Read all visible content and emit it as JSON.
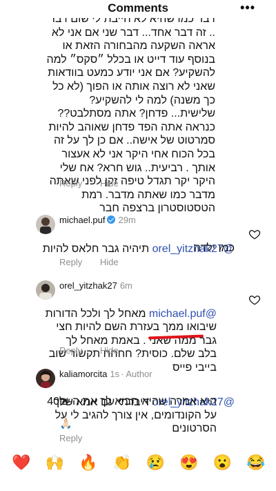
{
  "header": {
    "title": "Comments",
    "more_icon": "more-horizontal-icon"
  },
  "comments": [
    {
      "text": "דבר כמו שהיא לא חייבת לי שום דבר .. זה דבר אחד... דבר שני אם אני לא אראה השקעה מהבחורה הזאת או בנוסף עוד דייט או בכלל ״סקס״ למה להשקיע? אם אני יודע כמעט בוודאות שאני לא רוצה אותה או הפוך (לא כל כך משנה) למה לי להשקיע? שלישית... פדחן? אתה מסתלבט?? כנראה אתה הפד פדחן שאוהב להיות סמרטוט של אישה.. אם כן לך על זה בכל הכוח אחי היקר אני לא אעצור אותך . רביעית.. גוש חרא? אח שלי היקר יקר תגדל טיפה זקן לפני שאתה מדבר כמו שאתה מדבר. רמת הטסטוסטרון ברצפה חבר",
      "reply_label": "Reply",
      "hide_label": "Hide"
    },
    {
      "username": "michael.puf",
      "time": "29m",
      "mention": "@orel_yitzhak27",
      "text_line1": "תיהיה גבר חלאס להיות",
      "text_line2": "כמו ילדה",
      "reply_label": "Reply",
      "hide_label": "Hide"
    },
    {
      "username": "orel_yitzhak27",
      "time": "6m",
      "mention": "@michael.puf",
      "text": "מאחל לך ולכל הדורות שיבואו ממך בעזרת השם להיות חצי גבר ממה שאני . באמת מאחל לך בלב שלם. כוסית? חחחח תקשור שוב בייבי פייס",
      "reply_label": "Reply",
      "hide_label": "Hide"
    },
    {
      "username": "kaliamorcita",
      "time": "1s",
      "author_tag": "· Author",
      "mention": "@orel_yitzhak27",
      "text_line1": "דיברתי עם אמא שלך",
      "text_rest": "היא אמרה שהיא תביא לך את ה-40₪ על הקונדומים, אין צורך להגיב לי על הסרטונים",
      "emoji": "🙏🏻",
      "reply_label": "Reply"
    }
  ],
  "reactions": [
    "❤️",
    "🙌",
    "🔥",
    "👏",
    "😢",
    "😍",
    "😮",
    "😂"
  ],
  "colors": {
    "mention": "#2f4fb0",
    "muted": "#8e8e8e",
    "underline": "#e0141b"
  }
}
